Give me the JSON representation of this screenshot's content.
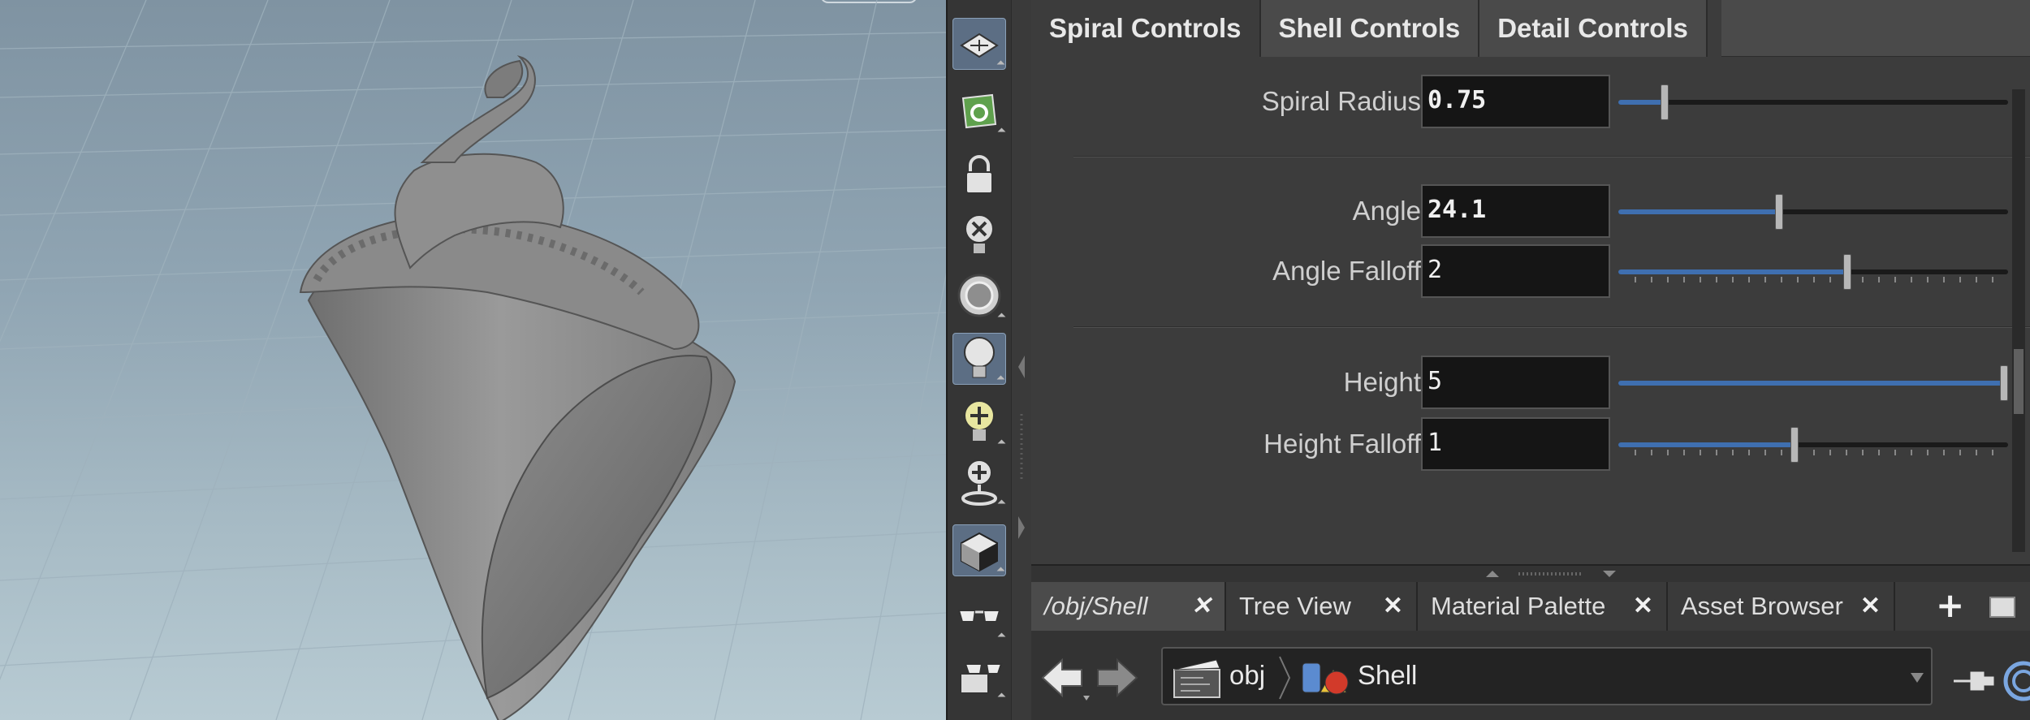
{
  "param_tabs": [
    {
      "label": "Spiral Controls",
      "active": true
    },
    {
      "label": "Shell Controls",
      "active": false
    },
    {
      "label": "Detail Controls",
      "active": false
    }
  ],
  "params": {
    "spiral_radius": {
      "label": "Spiral Radius",
      "value": "0.75",
      "slider_fraction": 0.11
    },
    "angle": {
      "label": "Angle",
      "value": "24.1",
      "slider_fraction": 0.41
    },
    "angle_falloff": {
      "label": "Angle Falloff",
      "value": "2",
      "slider_fraction": 0.59
    },
    "height": {
      "label": "Height",
      "value": "5",
      "slider_fraction": 1.0
    },
    "height_falloff": {
      "label": "Height Falloff",
      "value": "1",
      "slider_fraction": 0.45
    }
  },
  "network": {
    "tabs": [
      {
        "label": "/obj/Shell",
        "close": "✕"
      },
      {
        "label": "Tree View",
        "close": "✕"
      },
      {
        "label": "Material Palette",
        "close": "✕"
      },
      {
        "label": "Asset Browser",
        "close": "✕"
      }
    ],
    "add_tab": "+",
    "path": [
      "obj",
      "Shell"
    ]
  },
  "shelf_icons": [
    "view-icon",
    "snap-icon",
    "lock-icon",
    "light-off-icon",
    "headlight-icon",
    "light-bulb-icon",
    "add-light-icon",
    "spot-light-icon",
    "display-options-icon",
    "glasses-icon",
    "stereo-icon"
  ],
  "colors": {
    "slider_fill": "#3f6fb0",
    "active_tool": "#5c6e84"
  }
}
